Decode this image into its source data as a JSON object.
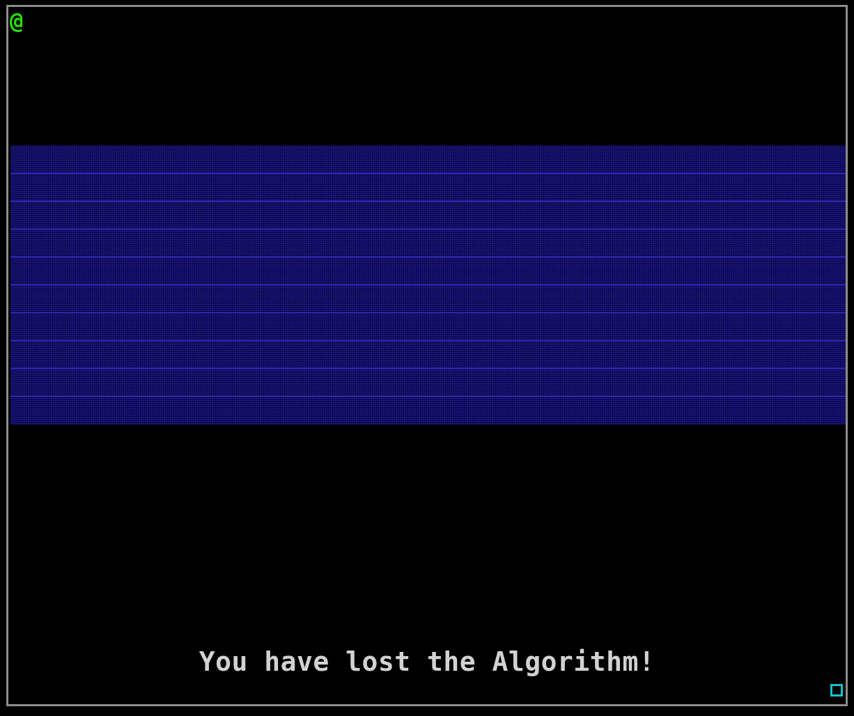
{
  "game": {
    "player_glyph": "@",
    "message": "You have lost the Algorithm!"
  },
  "colors": {
    "background": "#000000",
    "frame_border": "#8c8c8c",
    "player": "#22e400",
    "water": "#1c1590",
    "message_text": "#d2d2d2",
    "exit_tile": "#12c4cc"
  },
  "icons": {
    "player": "at-sign-player-icon",
    "exit": "hollow-square-icon"
  }
}
